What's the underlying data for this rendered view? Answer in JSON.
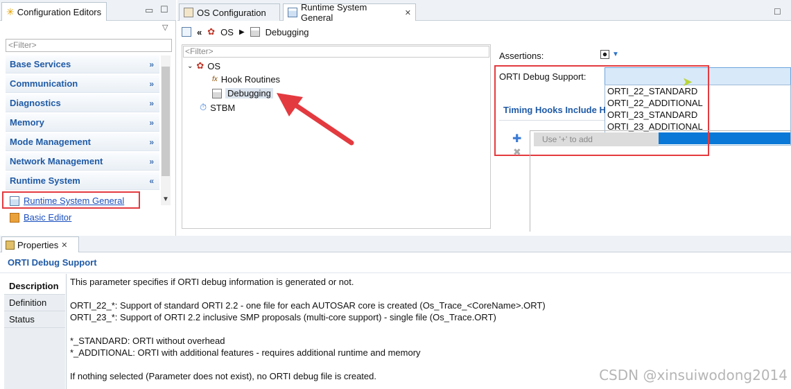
{
  "left_panel": {
    "tab_title": "Configuration Editors",
    "filter_placeholder": "<Filter>",
    "categories": [
      {
        "label": "Base Services",
        "chevron": "»"
      },
      {
        "label": "Communication",
        "chevron": "»"
      },
      {
        "label": "Diagnostics",
        "chevron": "»"
      },
      {
        "label": "Memory",
        "chevron": "»"
      },
      {
        "label": "Mode Management",
        "chevron": "»"
      },
      {
        "label": "Network Management",
        "chevron": "»"
      },
      {
        "label": "Runtime System",
        "chevron": "«"
      }
    ],
    "selected_editor": "Runtime System General",
    "basic_editor": "Basic Editor"
  },
  "editor_tabs": [
    {
      "label": "OS Configuration"
    },
    {
      "label": "Runtime System General",
      "close": "✕"
    }
  ],
  "breadcrumb": {
    "items": [
      "OS",
      "Debugging"
    ]
  },
  "tree": {
    "filter_placeholder": "<Filter>",
    "nodes": {
      "os": "OS",
      "hook_routines": "Hook Routines",
      "debugging": "Debugging",
      "stbm": "STBM"
    }
  },
  "details": {
    "assertions_label": "Assertions:",
    "orti_label": "ORTI Debug Support:",
    "timing_hooks_label": "Timing Hooks Include H",
    "add_hint": "Use '+' to add",
    "dropdown_options": [
      "ORTI_22_STANDARD",
      "ORTI_22_ADDITIONAL",
      "ORTI_23_STANDARD",
      "ORTI_23_ADDITIONAL",
      ""
    ]
  },
  "properties": {
    "tab_title": "Properties",
    "heading": "ORTI Debug Support",
    "vtabs": [
      "Description",
      "Definition",
      "Status"
    ],
    "description": [
      "This parameter specifies if ORTI debug information is generated or not.",
      "ORTI_22_*: Support of standard ORTI 2.2 - one file for each AUTOSAR core is created (Os_Trace_<CoreName>.ORT)",
      "ORTI_23_*: Support of ORTI 2.2 inclusive SMP proposals (multi-core support) - single file (Os_Trace.ORT)",
      "*_STANDARD: ORTI without overhead",
      "*_ADDITIONAL: ORTI with additional features - requires additional runtime and memory",
      "If nothing selected (Parameter does not exist), no ORTI debug file is created."
    ]
  },
  "watermark": "CSDN @xinsuiwodong2014",
  "colors": {
    "accent": "#1f5aa6",
    "highlight": "#0a78d7",
    "annotation_red": "#e33a3f"
  }
}
